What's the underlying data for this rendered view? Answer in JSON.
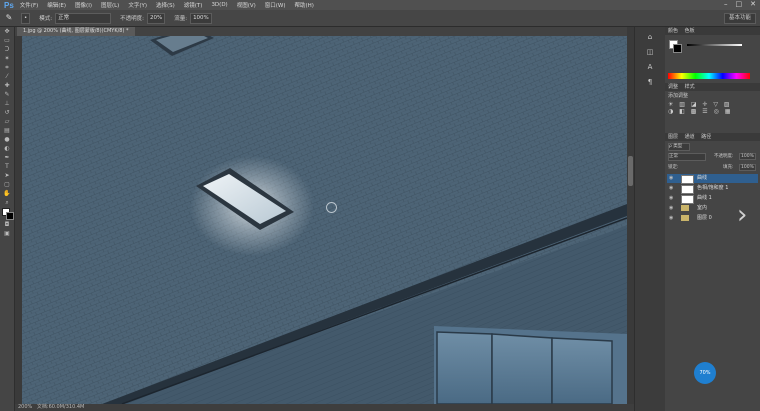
{
  "app": {
    "logo": "Ps"
  },
  "menubar": {
    "items": [
      "文件(F)",
      "编辑(E)",
      "图像(I)",
      "图层(L)",
      "文字(Y)",
      "选择(S)",
      "滤镜(T)",
      "3D(D)",
      "视图(V)",
      "窗口(W)",
      "帮助(H)"
    ],
    "window_controls": [
      "–",
      "□",
      "✕"
    ]
  },
  "options_bar": {
    "mode_label": "模式:",
    "mode_value": "正常",
    "opacity_label": "不透明度:",
    "opacity_value": "20%",
    "flow_label": "流量:",
    "flow_value": "100%",
    "workspace": "基本功能"
  },
  "document_tab": {
    "title": "1.jpg @ 200% (曲线, 图层蒙版/8)(CMYK/8) *"
  },
  "status_bar": {
    "zoom": "200%",
    "doc": "文档:60.0M/310.4M"
  },
  "panels": {
    "color_tabs": [
      "颜色",
      "色板"
    ],
    "adjust_tabs": [
      "调整",
      "样式"
    ],
    "adjust_heading": "添加调整",
    "layers_tabs": [
      "图层",
      "通道",
      "路径"
    ],
    "kind_label": "ρ 类型",
    "blend_mode": "正常",
    "opacity_label": "不透明度:",
    "opacity_value": "100%",
    "lock_label": "锁定:",
    "fill_label": "填充:",
    "fill_value": "100%",
    "layers": [
      {
        "name": "曲线",
        "kind": "adjustment",
        "selected": true
      },
      {
        "name": "色相/饱和度 1",
        "kind": "adjustment",
        "selected": false
      },
      {
        "name": "曲线 1",
        "kind": "adjustment",
        "selected": false
      },
      {
        "name": "室内",
        "kind": "folder",
        "selected": false
      },
      {
        "name": "图层 0",
        "kind": "folder",
        "selected": false
      }
    ]
  },
  "badge": {
    "text": "70%"
  },
  "colors": {
    "ui_dark": "#3a3a3a",
    "panel": "#454545",
    "selection": "#2f5f8f",
    "accent": "#1f7fd0",
    "roof": "#4a5f72"
  },
  "icons": [
    "brush-icon",
    "eye-icon",
    "folder-icon",
    "next-arrow-icon",
    "cursor-circle-icon"
  ]
}
